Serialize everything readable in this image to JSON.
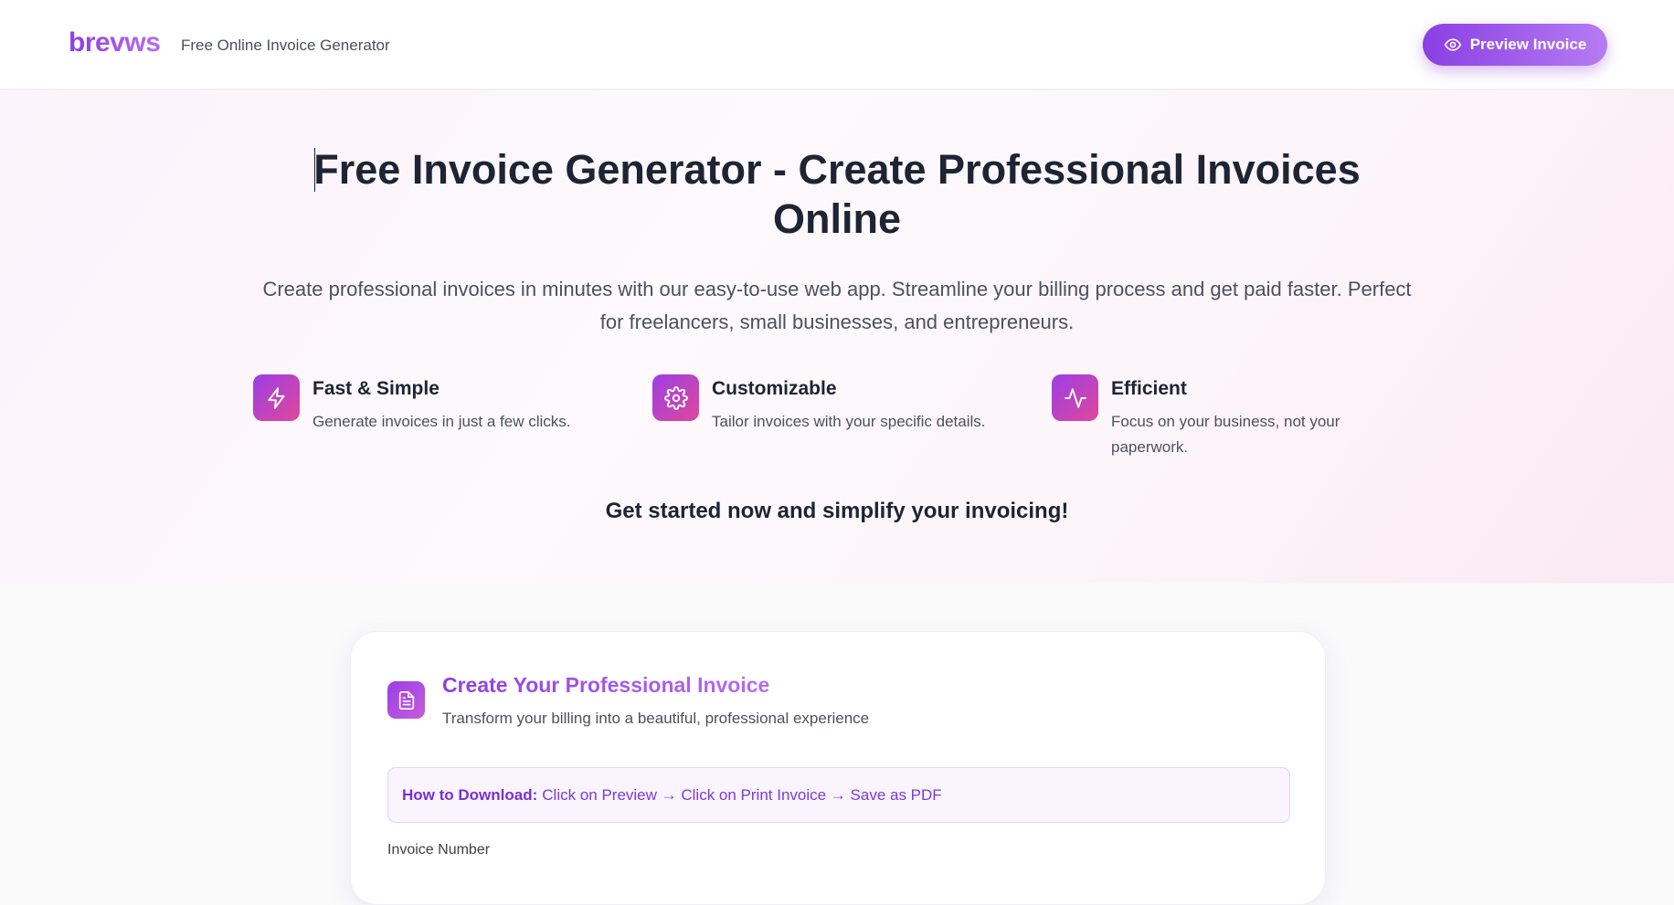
{
  "header": {
    "brand": "brevws",
    "tagline": "Free Online Invoice Generator",
    "preview_label": "Preview Invoice"
  },
  "hero": {
    "title": "Free Invoice Generator - Create Professional Invoices Online",
    "subtitle": "Create professional invoices in minutes with our easy-to-use web app. Streamline your billing process and get paid faster. Perfect for freelancers, small businesses, and entrepreneurs.",
    "features": [
      {
        "icon": "lightning-icon",
        "title": "Fast & Simple",
        "description": "Generate invoices in just a few clicks."
      },
      {
        "icon": "gear-icon",
        "title": "Customizable",
        "description": "Tailor invoices with your specific details."
      },
      {
        "icon": "activity-icon",
        "title": "Efficient",
        "description": "Focus on your business, not your paperwork."
      }
    ],
    "cta": "Get started now and simplify your invoicing!"
  },
  "card": {
    "icon": "document-icon",
    "title": "Create Your Professional Invoice",
    "subtitle": "Transform your billing into a beautiful, professional experience",
    "notice_label": "How to Download:",
    "notice_text": "Click on Preview → Click on Print Invoice → Save as PDF",
    "first_field_label": "Invoice Number"
  },
  "colors": {
    "accent": "#8a3fe3",
    "accent_light": "#b57cf2",
    "icon_gradient_end": "#e0479a",
    "text_dark": "#1d2433"
  }
}
